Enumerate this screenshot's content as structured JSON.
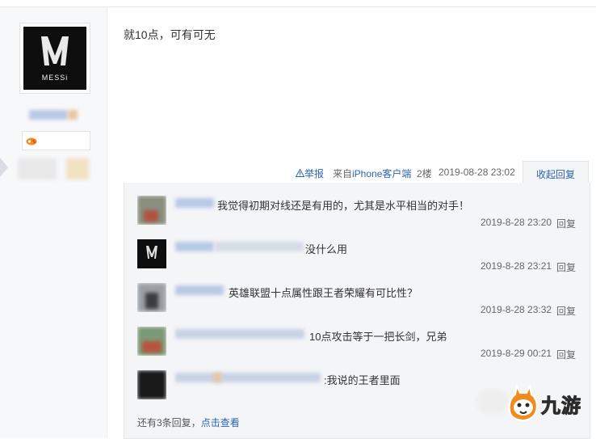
{
  "post": {
    "text": "就10点，可有可无",
    "report_label": "举报",
    "client_prefix": "来自",
    "client_name": "iPhone客户端",
    "floor": "2楼",
    "timestamp": "2019-08-28 23:02",
    "collapse_label": "收起回复"
  },
  "author": {
    "avatar_text": "MESSi"
  },
  "replies": [
    {
      "text": "我觉得初期对线还是有用的，尤其是水平相当的对手！",
      "time": "2019-8-28 23:20",
      "reply_label": "回复"
    },
    {
      "text": "没什么用",
      "time": "2019-8-28 23:21",
      "reply_label": "回复"
    },
    {
      "text": "英雄联盟十点属性跟王者荣耀有可比性？",
      "time": "2019-8-28 23:32",
      "reply_label": "回复"
    },
    {
      "text": "10点攻击等于一把长剑，兄弟",
      "time": "2019-8-29 00:21",
      "reply_label": "回复"
    },
    {
      "text": ":我说的王者里面",
      "time": "",
      "reply_label": ""
    }
  ],
  "more_replies": {
    "prefix": "还有3条回复，",
    "link": "点击查看"
  },
  "watermark": {
    "text": "九游"
  },
  "colors": {
    "link": "#2d64b3",
    "panel_bg": "#f4f5f7",
    "logo_orange": "#f08c1e"
  }
}
